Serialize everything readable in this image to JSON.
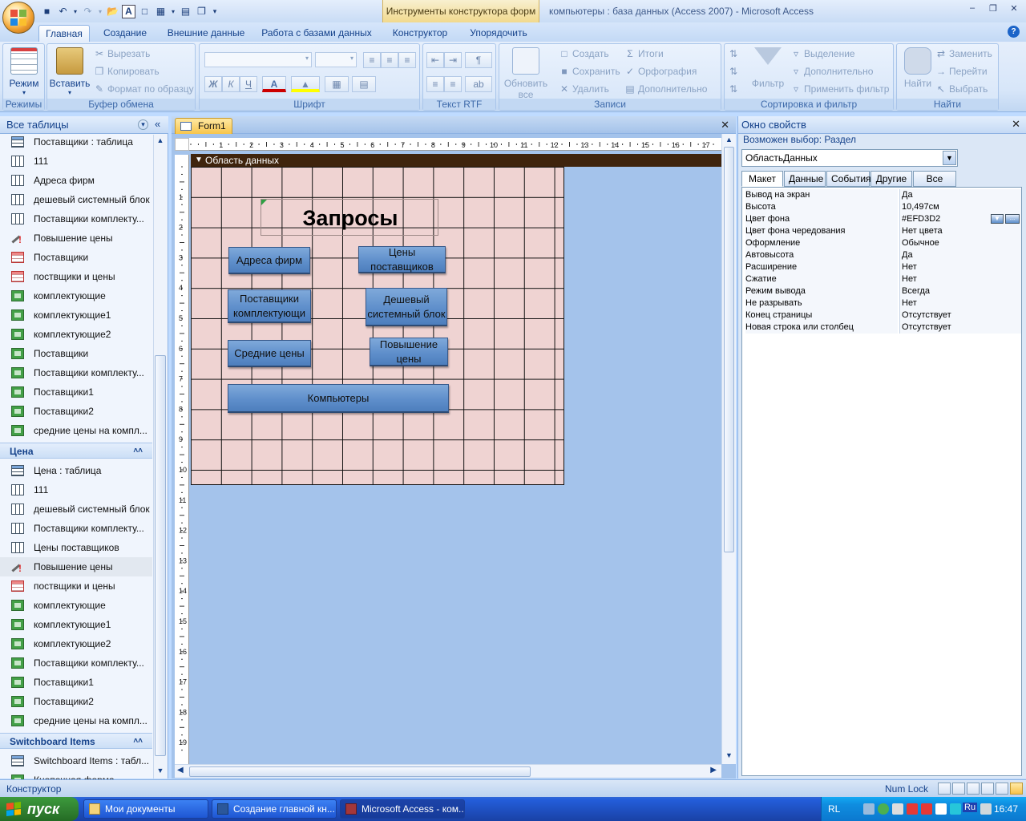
{
  "window": {
    "context_tab": "Инструменты конструктора форм",
    "title": "компьютеры : база данных (Access 2007) - Microsoft Access"
  },
  "ribbon_tabs": [
    "Главная",
    "Создание",
    "Внешние данные",
    "Работа с базами данных",
    "Конструктор",
    "Упорядочить"
  ],
  "ribbon": {
    "modes": {
      "group": "Режимы",
      "view": "Режим"
    },
    "clipboard": {
      "group": "Буфер обмена",
      "paste": "Вставить",
      "cut": "Вырезать",
      "copy": "Копировать",
      "format_painter": "Формат по образцу"
    },
    "font": {
      "group": "Шрифт",
      "bold": "Ж",
      "italic": "К",
      "underline": "Ч",
      "font_color": "A"
    },
    "rich_text": {
      "group": "Текст RTF"
    },
    "records": {
      "group": "Записи",
      "refresh": "Обновить",
      "refresh2": "все",
      "new": "Создать",
      "save": "Сохранить",
      "delete": "Удалить",
      "totals": "Итоги",
      "spelling": "Орфография",
      "more": "Дополнительно"
    },
    "sort_filter": {
      "group": "Сортировка и фильтр",
      "filter": "Фильтр",
      "selection": "Выделение",
      "advanced": "Дополнительно",
      "apply_filter": "Применить фильтр"
    },
    "find": {
      "group": "Найти",
      "find": "Найти",
      "replace": "Заменить",
      "goto": "Перейти",
      "select": "Выбрать"
    }
  },
  "nav": {
    "title": "Все таблицы",
    "group1_items": [
      {
        "label": "Поставщики : таблица",
        "icon": "table"
      },
      {
        "label": "111",
        "icon": "query"
      },
      {
        "label": "Адреса фирм",
        "icon": "query"
      },
      {
        "label": "дешевый системный блок",
        "icon": "query"
      },
      {
        "label": "Поставщики комплекту...",
        "icon": "query"
      },
      {
        "label": "Повышение цены",
        "icon": "update-query"
      },
      {
        "label": "Поставщики",
        "icon": "query2"
      },
      {
        "label": "поствщики и цены",
        "icon": "query2"
      },
      {
        "label": "комплектующие",
        "icon": "form"
      },
      {
        "label": "комплектующие1",
        "icon": "form"
      },
      {
        "label": "комплектующие2",
        "icon": "form"
      },
      {
        "label": "Поставщики",
        "icon": "form"
      },
      {
        "label": "Поставщики комплекту...",
        "icon": "form"
      },
      {
        "label": "Поставщики1",
        "icon": "form"
      },
      {
        "label": "Поставщики2",
        "icon": "form"
      },
      {
        "label": "средние цены на компл...",
        "icon": "form"
      }
    ],
    "group2_title": "Цена",
    "group2_items": [
      {
        "label": "Цена : таблица",
        "icon": "table"
      },
      {
        "label": "111",
        "icon": "query"
      },
      {
        "label": "дешевый системный блок",
        "icon": "query"
      },
      {
        "label": "Поставщики комплекту...",
        "icon": "query"
      },
      {
        "label": "Цены поставщиков",
        "icon": "query"
      },
      {
        "label": "Повышение цены",
        "icon": "update-query"
      },
      {
        "label": "поствщики и цены",
        "icon": "query2"
      },
      {
        "label": "комплектующие",
        "icon": "form"
      },
      {
        "label": "комплектующие1",
        "icon": "form"
      },
      {
        "label": "комплектующие2",
        "icon": "form"
      },
      {
        "label": "Поставщики комплекту...",
        "icon": "form"
      },
      {
        "label": "Поставщики1",
        "icon": "form"
      },
      {
        "label": "Поставщики2",
        "icon": "form"
      },
      {
        "label": "средние цены на компл...",
        "icon": "form"
      }
    ],
    "group3_title": "Switchboard Items",
    "group3_items": [
      {
        "label": "Switchboard Items : табл...",
        "icon": "table"
      },
      {
        "label": "Кнопочная форма",
        "icon": "form"
      }
    ]
  },
  "document": {
    "tab": "Form1",
    "section": "Область данных",
    "form_title": "Запросы",
    "buttons": {
      "b1": "Адреса фирм",
      "b2": "Цены поставщиков",
      "b3": "Поставщики комплектующи",
      "b4": "Дешевый системный блок",
      "b5": "Средние цены",
      "b6": "Повышение цены",
      "b7": "Компьютеры"
    },
    "hruler_ticks": [
      "1",
      "2",
      "3",
      "4",
      "5",
      "6",
      "7",
      "8",
      "9",
      "10",
      "11",
      "12",
      "13",
      "14",
      "15",
      "16",
      "17"
    ],
    "vruler_ticks": [
      "1",
      "2",
      "3",
      "4",
      "5",
      "6",
      "7",
      "8",
      "9",
      "10",
      "11",
      "12",
      "13",
      "14",
      "15",
      "16",
      "17",
      "18",
      "19"
    ]
  },
  "properties": {
    "title": "Окно свойств",
    "selection_type": "Возможен выбор:  Раздел",
    "selected_object": "ОбластьДанных",
    "tabs": [
      "Макет",
      "Данные",
      "События",
      "Другие",
      "Все"
    ],
    "rows": [
      {
        "name": "Вывод на экран",
        "value": "Да"
      },
      {
        "name": "Высота",
        "value": "10,497см"
      },
      {
        "name": "Цвет фона",
        "value": "#EFD3D2"
      },
      {
        "name": "Цвет фона чередования",
        "value": "Нет цвета"
      },
      {
        "name": "Оформление",
        "value": "Обычное"
      },
      {
        "name": "Автовысота",
        "value": "Да"
      },
      {
        "name": "Расширение",
        "value": "Нет"
      },
      {
        "name": "Сжатие",
        "value": "Нет"
      },
      {
        "name": "Режим вывода",
        "value": "Всегда"
      },
      {
        "name": "Не разрывать",
        "value": "Нет"
      },
      {
        "name": "Конец страницы",
        "value": "Отсутствует"
      },
      {
        "name": "Новая строка или столбец",
        "value": "Отсутствует"
      }
    ]
  },
  "status": {
    "left": "Конструктор",
    "num_lock": "Num Lock"
  },
  "taskbar": {
    "start": "пуск",
    "items": [
      "Мои документы",
      "Создание главной кн...",
      "Microsoft Access - ком..."
    ],
    "lang": "RL",
    "kbd": "Ru",
    "clock": "16:47"
  },
  "colors": {
    "section_background": "#EFD3D2",
    "section_bar": "#3F240D",
    "button_blue": "#5F8FCB"
  }
}
